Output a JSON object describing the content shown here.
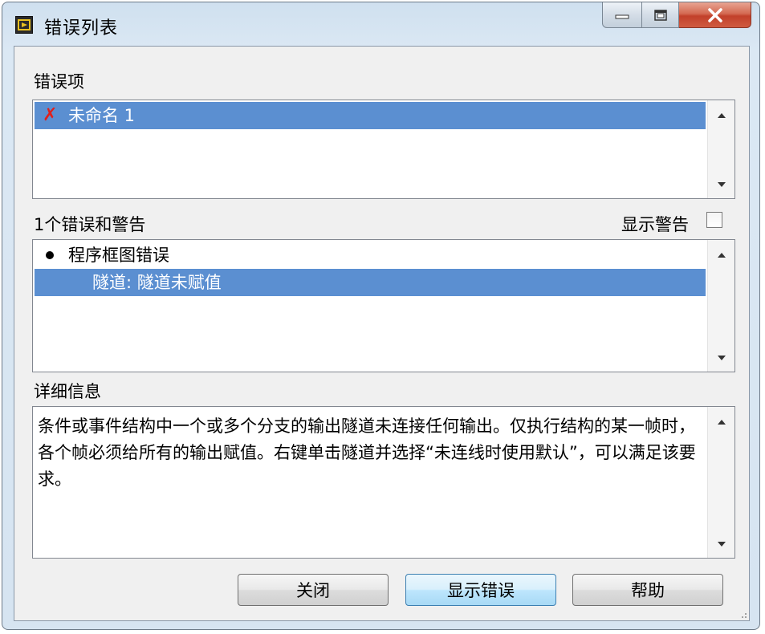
{
  "window": {
    "title": "错误列表"
  },
  "error_items": {
    "label": "错误项",
    "items": [
      {
        "name": "未命名 1",
        "icon": "error-x-icon",
        "selected": true
      }
    ]
  },
  "errors_warnings": {
    "label": "1个错误和警告",
    "show_warnings_label": "显示警告",
    "show_warnings_checked": false,
    "items": [
      {
        "text": "程序框图错误",
        "type": "group",
        "selected": false
      },
      {
        "text": "隧道: 隧道未赋值",
        "type": "item",
        "selected": true
      }
    ]
  },
  "details": {
    "label": "详细信息",
    "text": "条件或事件结构中一个或多个分支的输出隧道未连接任何输出。仅执行结构的某一帧时，各个帧必须给所有的输出赋值。右键单击隧道并选择“未连线时使用默认”，可以满足该要求。"
  },
  "buttons": {
    "close": "关闭",
    "show_error": "显示错误",
    "help": "帮助"
  },
  "colors": {
    "selection": "#5b8fd1",
    "error_icon": "#e0201c",
    "close_button": "#c2402a"
  }
}
